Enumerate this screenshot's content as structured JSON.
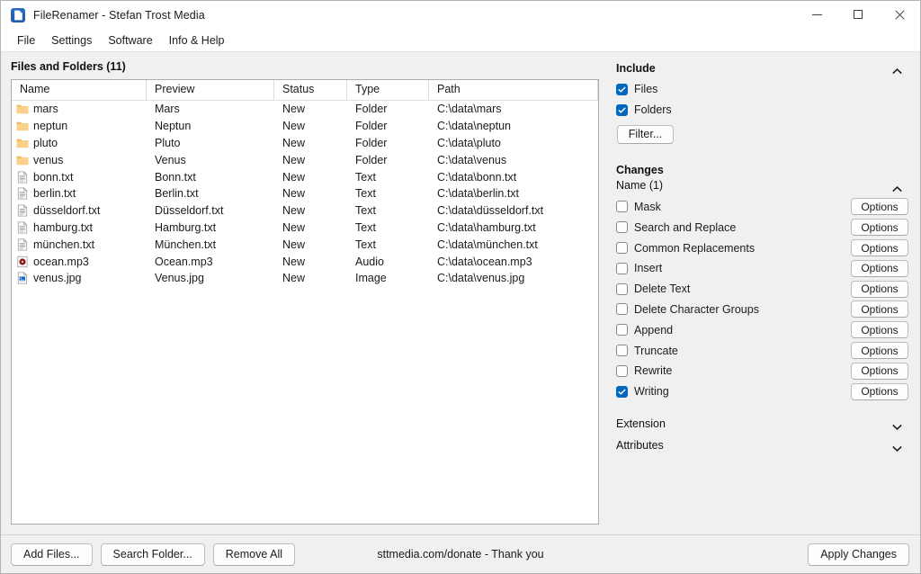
{
  "window": {
    "title": "FileRenamer - Stefan Trost Media",
    "app_icon": "document-icon",
    "controls": {
      "minimize": "minimize-icon",
      "maximize": "maximize-icon",
      "close": "close-icon"
    }
  },
  "menubar": {
    "items": [
      {
        "label": "File"
      },
      {
        "label": "Settings"
      },
      {
        "label": "Software"
      },
      {
        "label": "Info & Help"
      }
    ]
  },
  "files_panel": {
    "caption": "Files and Folders (11)",
    "columns": [
      {
        "label": "Name"
      },
      {
        "label": "Preview"
      },
      {
        "label": "Status"
      },
      {
        "label": "Type"
      },
      {
        "label": "Path"
      }
    ],
    "rows": [
      {
        "icon": "folder-icon",
        "name": "mars",
        "preview": "Mars",
        "status": "New",
        "type": "Folder",
        "path": "C:\\data\\mars"
      },
      {
        "icon": "folder-icon",
        "name": "neptun",
        "preview": "Neptun",
        "status": "New",
        "type": "Folder",
        "path": "C:\\data\\neptun"
      },
      {
        "icon": "folder-icon",
        "name": "pluto",
        "preview": "Pluto",
        "status": "New",
        "type": "Folder",
        "path": "C:\\data\\pluto"
      },
      {
        "icon": "folder-icon",
        "name": "venus",
        "preview": "Venus",
        "status": "New",
        "type": "Folder",
        "path": "C:\\data\\venus"
      },
      {
        "icon": "text-file-icon",
        "name": "bonn.txt",
        "preview": "Bonn.txt",
        "status": "New",
        "type": "Text",
        "path": "C:\\data\\bonn.txt"
      },
      {
        "icon": "text-file-icon",
        "name": "berlin.txt",
        "preview": "Berlin.txt",
        "status": "New",
        "type": "Text",
        "path": "C:\\data\\berlin.txt"
      },
      {
        "icon": "text-file-icon",
        "name": "düsseldorf.txt",
        "preview": "Düsseldorf.txt",
        "status": "New",
        "type": "Text",
        "path": "C:\\data\\düsseldorf.txt"
      },
      {
        "icon": "text-file-icon",
        "name": "hamburg.txt",
        "preview": "Hamburg.txt",
        "status": "New",
        "type": "Text",
        "path": "C:\\data\\hamburg.txt"
      },
      {
        "icon": "text-file-icon",
        "name": "münchen.txt",
        "preview": "München.txt",
        "status": "New",
        "type": "Text",
        "path": "C:\\data\\münchen.txt"
      },
      {
        "icon": "audio-file-icon",
        "name": "ocean.mp3",
        "preview": "Ocean.mp3",
        "status": "New",
        "type": "Audio",
        "path": "C:\\data\\ocean.mp3"
      },
      {
        "icon": "image-file-icon",
        "name": "venus.jpg",
        "preview": "Venus.jpg",
        "status": "New",
        "type": "Image",
        "path": "C:\\data\\venus.jpg"
      }
    ]
  },
  "sidebar": {
    "include": {
      "title": "Include",
      "expanded": true,
      "collapse_icon": "chevron-up-icon",
      "checkboxes": [
        {
          "label": "Files",
          "checked": true
        },
        {
          "label": "Folders",
          "checked": true
        }
      ],
      "filter_button": "Filter..."
    },
    "changes": {
      "title": "Changes",
      "name_group": {
        "label": "Name (1)",
        "expanded": true,
        "collapse_icon": "chevron-up-icon"
      },
      "options_button_label": "Options",
      "items": [
        {
          "label": "Mask",
          "checked": false
        },
        {
          "label": "Search and Replace",
          "checked": false
        },
        {
          "label": "Common Replacements",
          "checked": false
        },
        {
          "label": "Insert",
          "checked": false
        },
        {
          "label": "Delete Text",
          "checked": false
        },
        {
          "label": "Delete Character Groups",
          "checked": false
        },
        {
          "label": "Append",
          "checked": false
        },
        {
          "label": "Truncate",
          "checked": false
        },
        {
          "label": "Rewrite",
          "checked": false
        },
        {
          "label": "Writing",
          "checked": true
        }
      ]
    },
    "extension": {
      "label": "Extension",
      "expanded": false,
      "collapse_icon": "chevron-down-icon"
    },
    "attributes": {
      "label": "Attributes",
      "expanded": false,
      "collapse_icon": "chevron-down-icon"
    }
  },
  "footer": {
    "add_files": "Add Files...",
    "search_folder": "Search Folder...",
    "remove_all": "Remove All",
    "donate": "sttmedia.com/donate - Thank you",
    "apply_changes": "Apply Changes"
  },
  "colors": {
    "accent": "#0067c0",
    "window_bg": "#f0f0f0",
    "list_bg": "#ffffff",
    "folder": "#f7c873",
    "border": "#acacac"
  }
}
